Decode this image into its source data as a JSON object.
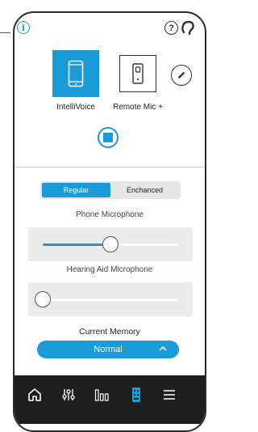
{
  "colors": {
    "accent": "#1a9ad6",
    "frame": "#2b2b2b",
    "navbar": "#1e1e1e"
  },
  "header": {
    "info_icon": "info-icon",
    "help_icon": "help-icon",
    "ear_icon": "ear-icon",
    "info_glyph": "i",
    "help_glyph": "?"
  },
  "devices": [
    {
      "label": "IntelliVoice",
      "icon": "smartphone-icon",
      "active": true
    },
    {
      "label": "Remote Mic +",
      "icon": "remote-mic-icon",
      "active": false
    }
  ],
  "edit_icon": "pencil-icon",
  "stop_icon": "stop-icon",
  "mode_toggle": {
    "options": [
      "Regular",
      "Enchanced"
    ],
    "selected": "Regular"
  },
  "phone_microphone": {
    "label": "Phone Microphone",
    "level": 0.5
  },
  "hearing_aid_microphone": {
    "label": "Hearing Aid Microphone",
    "level": 0.0
  },
  "memory": {
    "label": "Current Memory",
    "value": "Normal",
    "chevron": "chevron-up-icon"
  },
  "navbar": [
    {
      "icon": "home-icon",
      "active": false
    },
    {
      "icon": "sliders-icon",
      "active": false
    },
    {
      "icon": "equalizer-icon",
      "active": false
    },
    {
      "icon": "remote-icon",
      "active": true
    },
    {
      "icon": "menu-icon",
      "active": false
    }
  ]
}
